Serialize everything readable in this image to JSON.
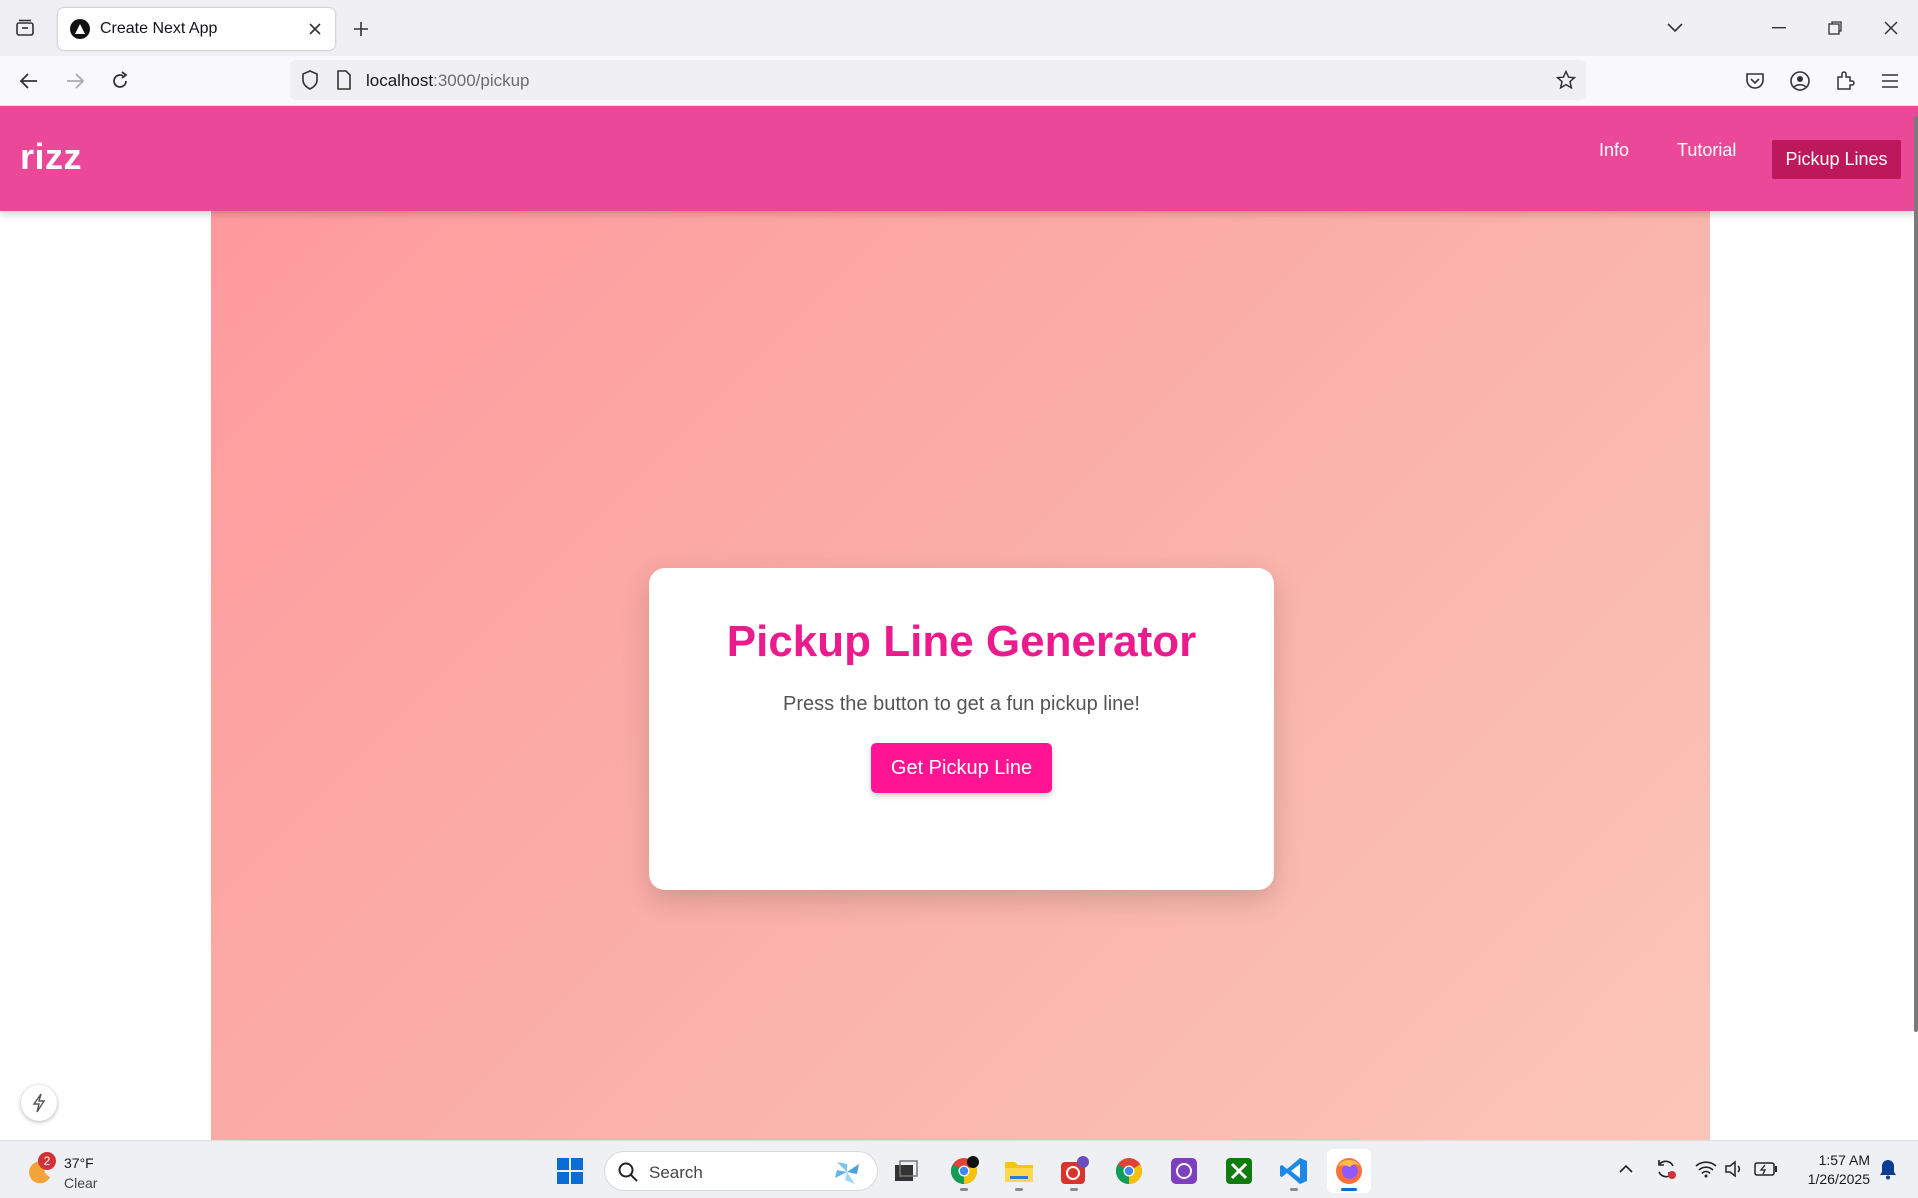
{
  "browser": {
    "tab_title": "Create Next App",
    "url_host": "localhost",
    "url_path": ":3000/pickup"
  },
  "site": {
    "brand": "rizz",
    "nav": {
      "info": "Info",
      "tutorial": "Tutorial",
      "pickup_lines": "Pickup Lines"
    },
    "card": {
      "title": "Pickup Line Generator",
      "subtitle": "Press the button to get a fun pickup line!",
      "button": "Get Pickup Line"
    },
    "colors": {
      "header": "#ec4899",
      "nav_active": "#be185d",
      "title": "#ec1b8d",
      "button": "#ff1493"
    }
  },
  "taskbar": {
    "weather_temp": "37°F",
    "weather_cond": "Clear",
    "weather_badge": "2",
    "search_placeholder": "Search",
    "time": "1:57 AM",
    "date": "1/26/2025"
  }
}
